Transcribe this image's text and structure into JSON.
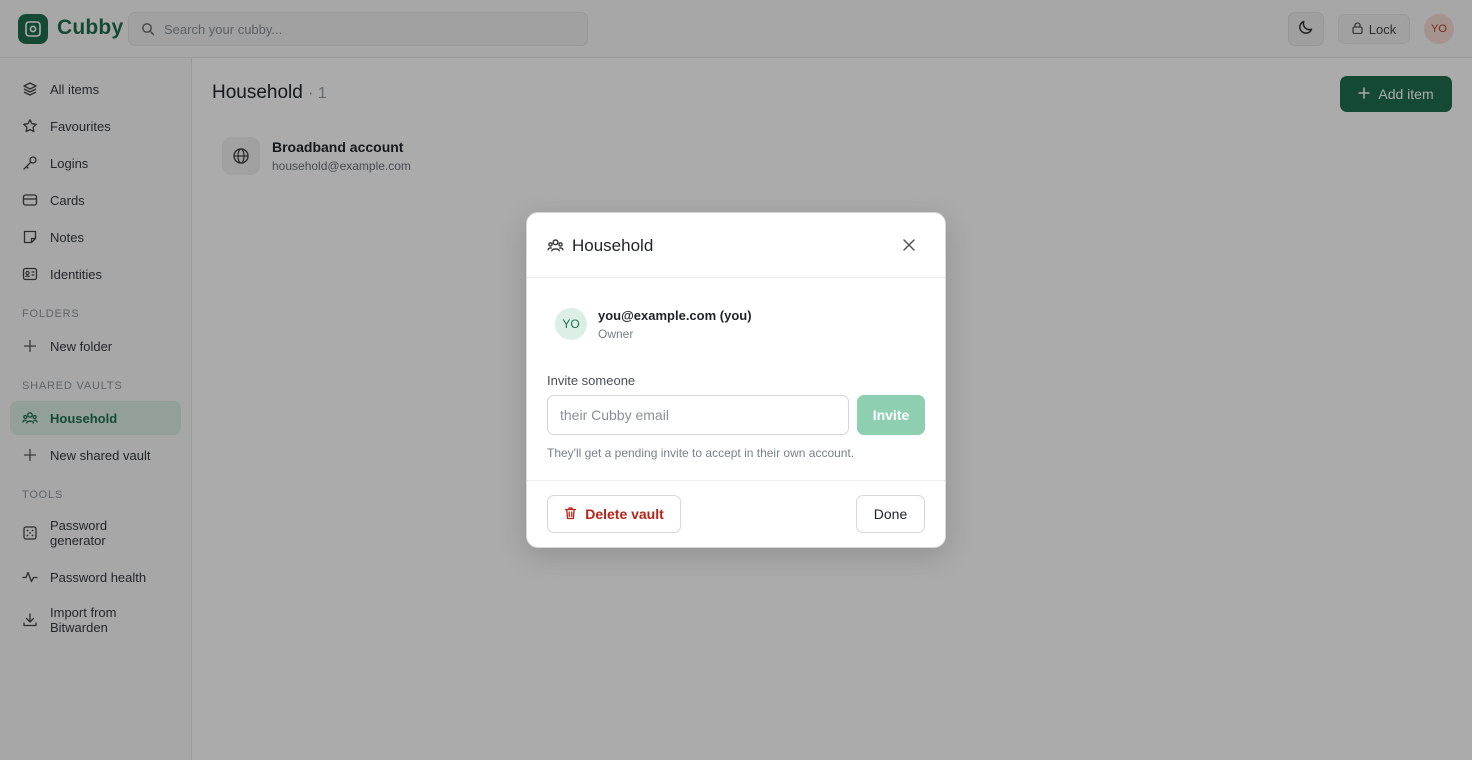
{
  "app": {
    "name": "Cubby",
    "search_placeholder": "Search your cubby...",
    "lock_label": "Lock",
    "user_initials": "YO"
  },
  "sidebar": {
    "items": [
      {
        "label": "All items",
        "icon": "layers-icon"
      },
      {
        "label": "Favourites",
        "icon": "star-icon"
      },
      {
        "label": "Logins",
        "icon": "key-icon"
      },
      {
        "label": "Cards",
        "icon": "card-icon"
      },
      {
        "label": "Notes",
        "icon": "note-icon"
      },
      {
        "label": "Identities",
        "icon": "id-card-icon"
      }
    ],
    "folders_title": "FOLDERS",
    "new_folder": "New folder",
    "shared_title": "SHARED VAULTS",
    "shared_vault": "Household",
    "new_shared_vault": "New shared vault",
    "tools_title": "TOOLS",
    "tools": {
      "password_generator": "Password generator",
      "password_health": "Password health",
      "import": "Import from Bitwarden"
    }
  },
  "main": {
    "title": "Household",
    "count": "· 1",
    "add_label": "Add item",
    "items": [
      {
        "title": "Broadband account",
        "subtitle": "household@example.com"
      }
    ]
  },
  "modal": {
    "title": "Household",
    "member": {
      "initials": "YO",
      "email": "you@example.com (you)",
      "role": "Owner"
    },
    "invite_label": "Invite someone",
    "invite_placeholder": "their Cubby email",
    "invite_button": "Invite",
    "invite_hint": "They'll get a pending invite to accept in their own account.",
    "delete_label": "Delete vault",
    "done_label": "Done"
  },
  "colors": {
    "brand": "#1f6f4e",
    "active_bg": "#dcefe5",
    "danger": "#b42318",
    "invite_disabled": "#8fcfb1"
  }
}
